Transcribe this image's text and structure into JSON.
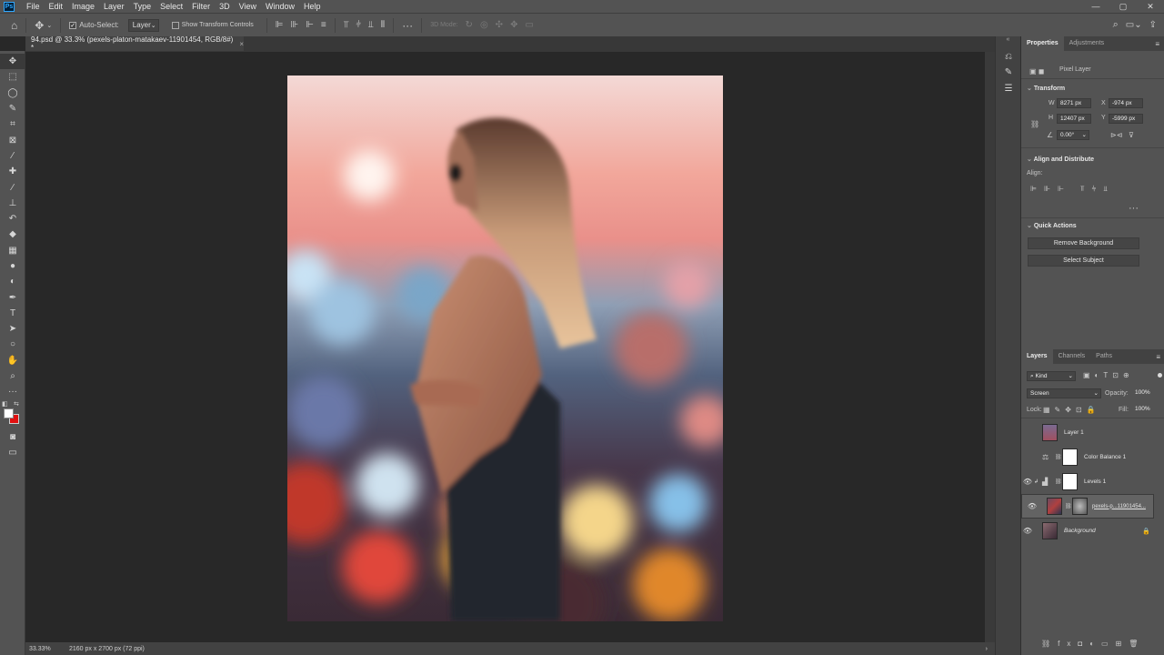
{
  "app": {
    "logo": "Ps"
  },
  "menu": [
    "File",
    "Edit",
    "Image",
    "Layer",
    "Type",
    "Select",
    "Filter",
    "3D",
    "View",
    "Window",
    "Help"
  ],
  "window_controls": [
    "—",
    "▢",
    "✕"
  ],
  "options": {
    "auto_select_label": "Auto-Select:",
    "auto_select_checked": true,
    "auto_select_target": "Layer",
    "show_transform_label": "Show Transform Controls",
    "mode_3d_label": "3D Mode:"
  },
  "document": {
    "tab_title": "94.psd @ 33.3% (pexels-platon-matakaev-11901454, RGB/8#) *",
    "zoom": "33.33%",
    "size_info": "2160 px x 2700 px (72 ppi)"
  },
  "tools": [
    "move-icon",
    "marquee-icon",
    "lasso-icon",
    "quick-select-icon",
    "crop-icon",
    "frame-icon",
    "eyedropper-icon",
    "healing-icon",
    "brush-icon",
    "stamp-icon",
    "history-brush-icon",
    "eraser-icon",
    "gradient-icon",
    "blur-icon",
    "dodge-icon",
    "pen-icon",
    "type-icon",
    "path-select-icon",
    "shape-icon",
    "hand-icon",
    "zoom-icon",
    "more-icon"
  ],
  "colors": {
    "foreground": "#ffffff",
    "background": "#e01010",
    "accent": "#31a8ff"
  },
  "properties": {
    "tabs": [
      "Properties",
      "Adjustments"
    ],
    "layer_type": "Pixel Layer",
    "transform_title": "Transform",
    "w_label": "W",
    "w_value": "8271 px",
    "h_label": "H",
    "h_value": "12407 px",
    "x_label": "X",
    "x_value": "-974 px",
    "y_label": "Y",
    "y_value": "-5999 px",
    "angle": "0.00°",
    "align_title": "Align and Distribute",
    "align_label": "Align:",
    "quick_actions_title": "Quick Actions",
    "remove_bg": "Remove Background",
    "select_subject": "Select Subject"
  },
  "layers_panel": {
    "tabs": [
      "Layers",
      "Channels",
      "Paths"
    ],
    "filter_kind": "Kind",
    "blend_mode": "Screen",
    "opacity_label": "Opacity:",
    "opacity": "100%",
    "lock_label": "Lock:",
    "fill_label": "Fill:",
    "fill": "100%",
    "layers": [
      {
        "name": "Layer 1",
        "visible": false
      },
      {
        "name": "Color Balance 1",
        "visible": false
      },
      {
        "name": "Levels 1",
        "visible": true
      },
      {
        "name": "pexels-p...11901454...",
        "visible": true
      },
      {
        "name": "Background",
        "visible": true
      }
    ]
  }
}
